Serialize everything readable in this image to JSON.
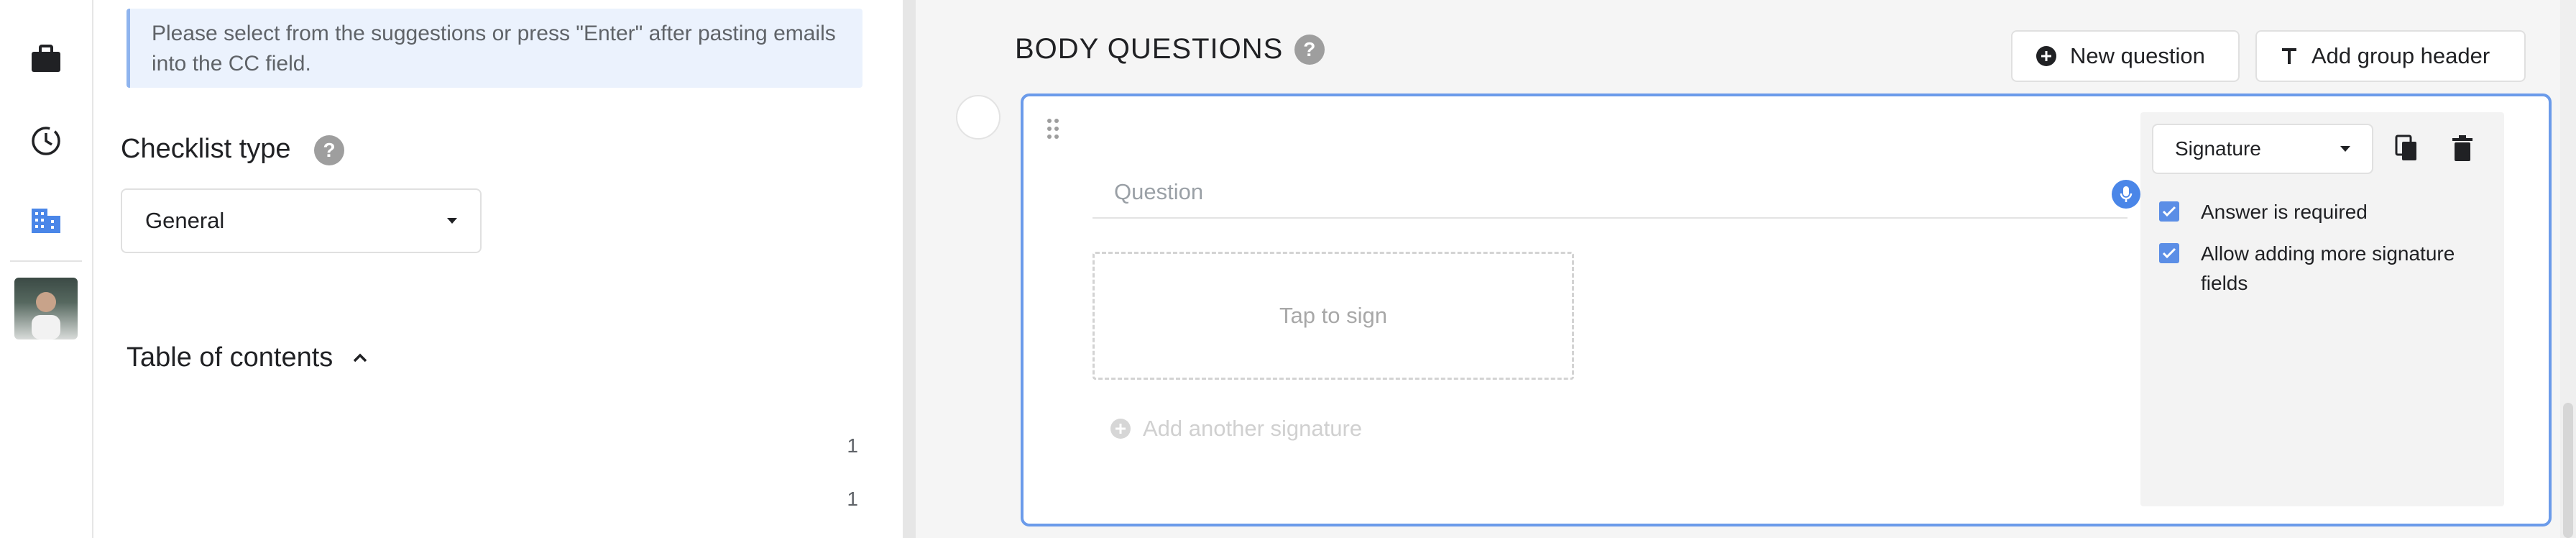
{
  "rail": {
    "items": [
      {
        "icon": "briefcase-icon"
      },
      {
        "icon": "history-icon"
      },
      {
        "icon": "building-icon"
      }
    ],
    "avatar": "user-avatar"
  },
  "left_panel": {
    "info_text": "Please select from the suggestions or press \"Enter\" after pasting emails into the CC field.",
    "checklist_type_heading": "Checklist type",
    "help_glyph": "?",
    "checklist_type_value": "General",
    "toc_heading": "Table of contents",
    "toc_numbers": [
      "1",
      "1"
    ]
  },
  "right_panel": {
    "section_title": "BODY QUESTIONS",
    "help_glyph": "?",
    "new_question_label": "New question",
    "add_group_header_label": "Add group header",
    "question_placeholder": "Question",
    "tap_to_sign": "Tap to sign",
    "add_another_signature": "Add another signature",
    "answer_type": "Signature",
    "answer_required_label": "Answer is required",
    "allow_more_label": "Allow adding more signature fields",
    "accent_color": "#4a86e8"
  }
}
